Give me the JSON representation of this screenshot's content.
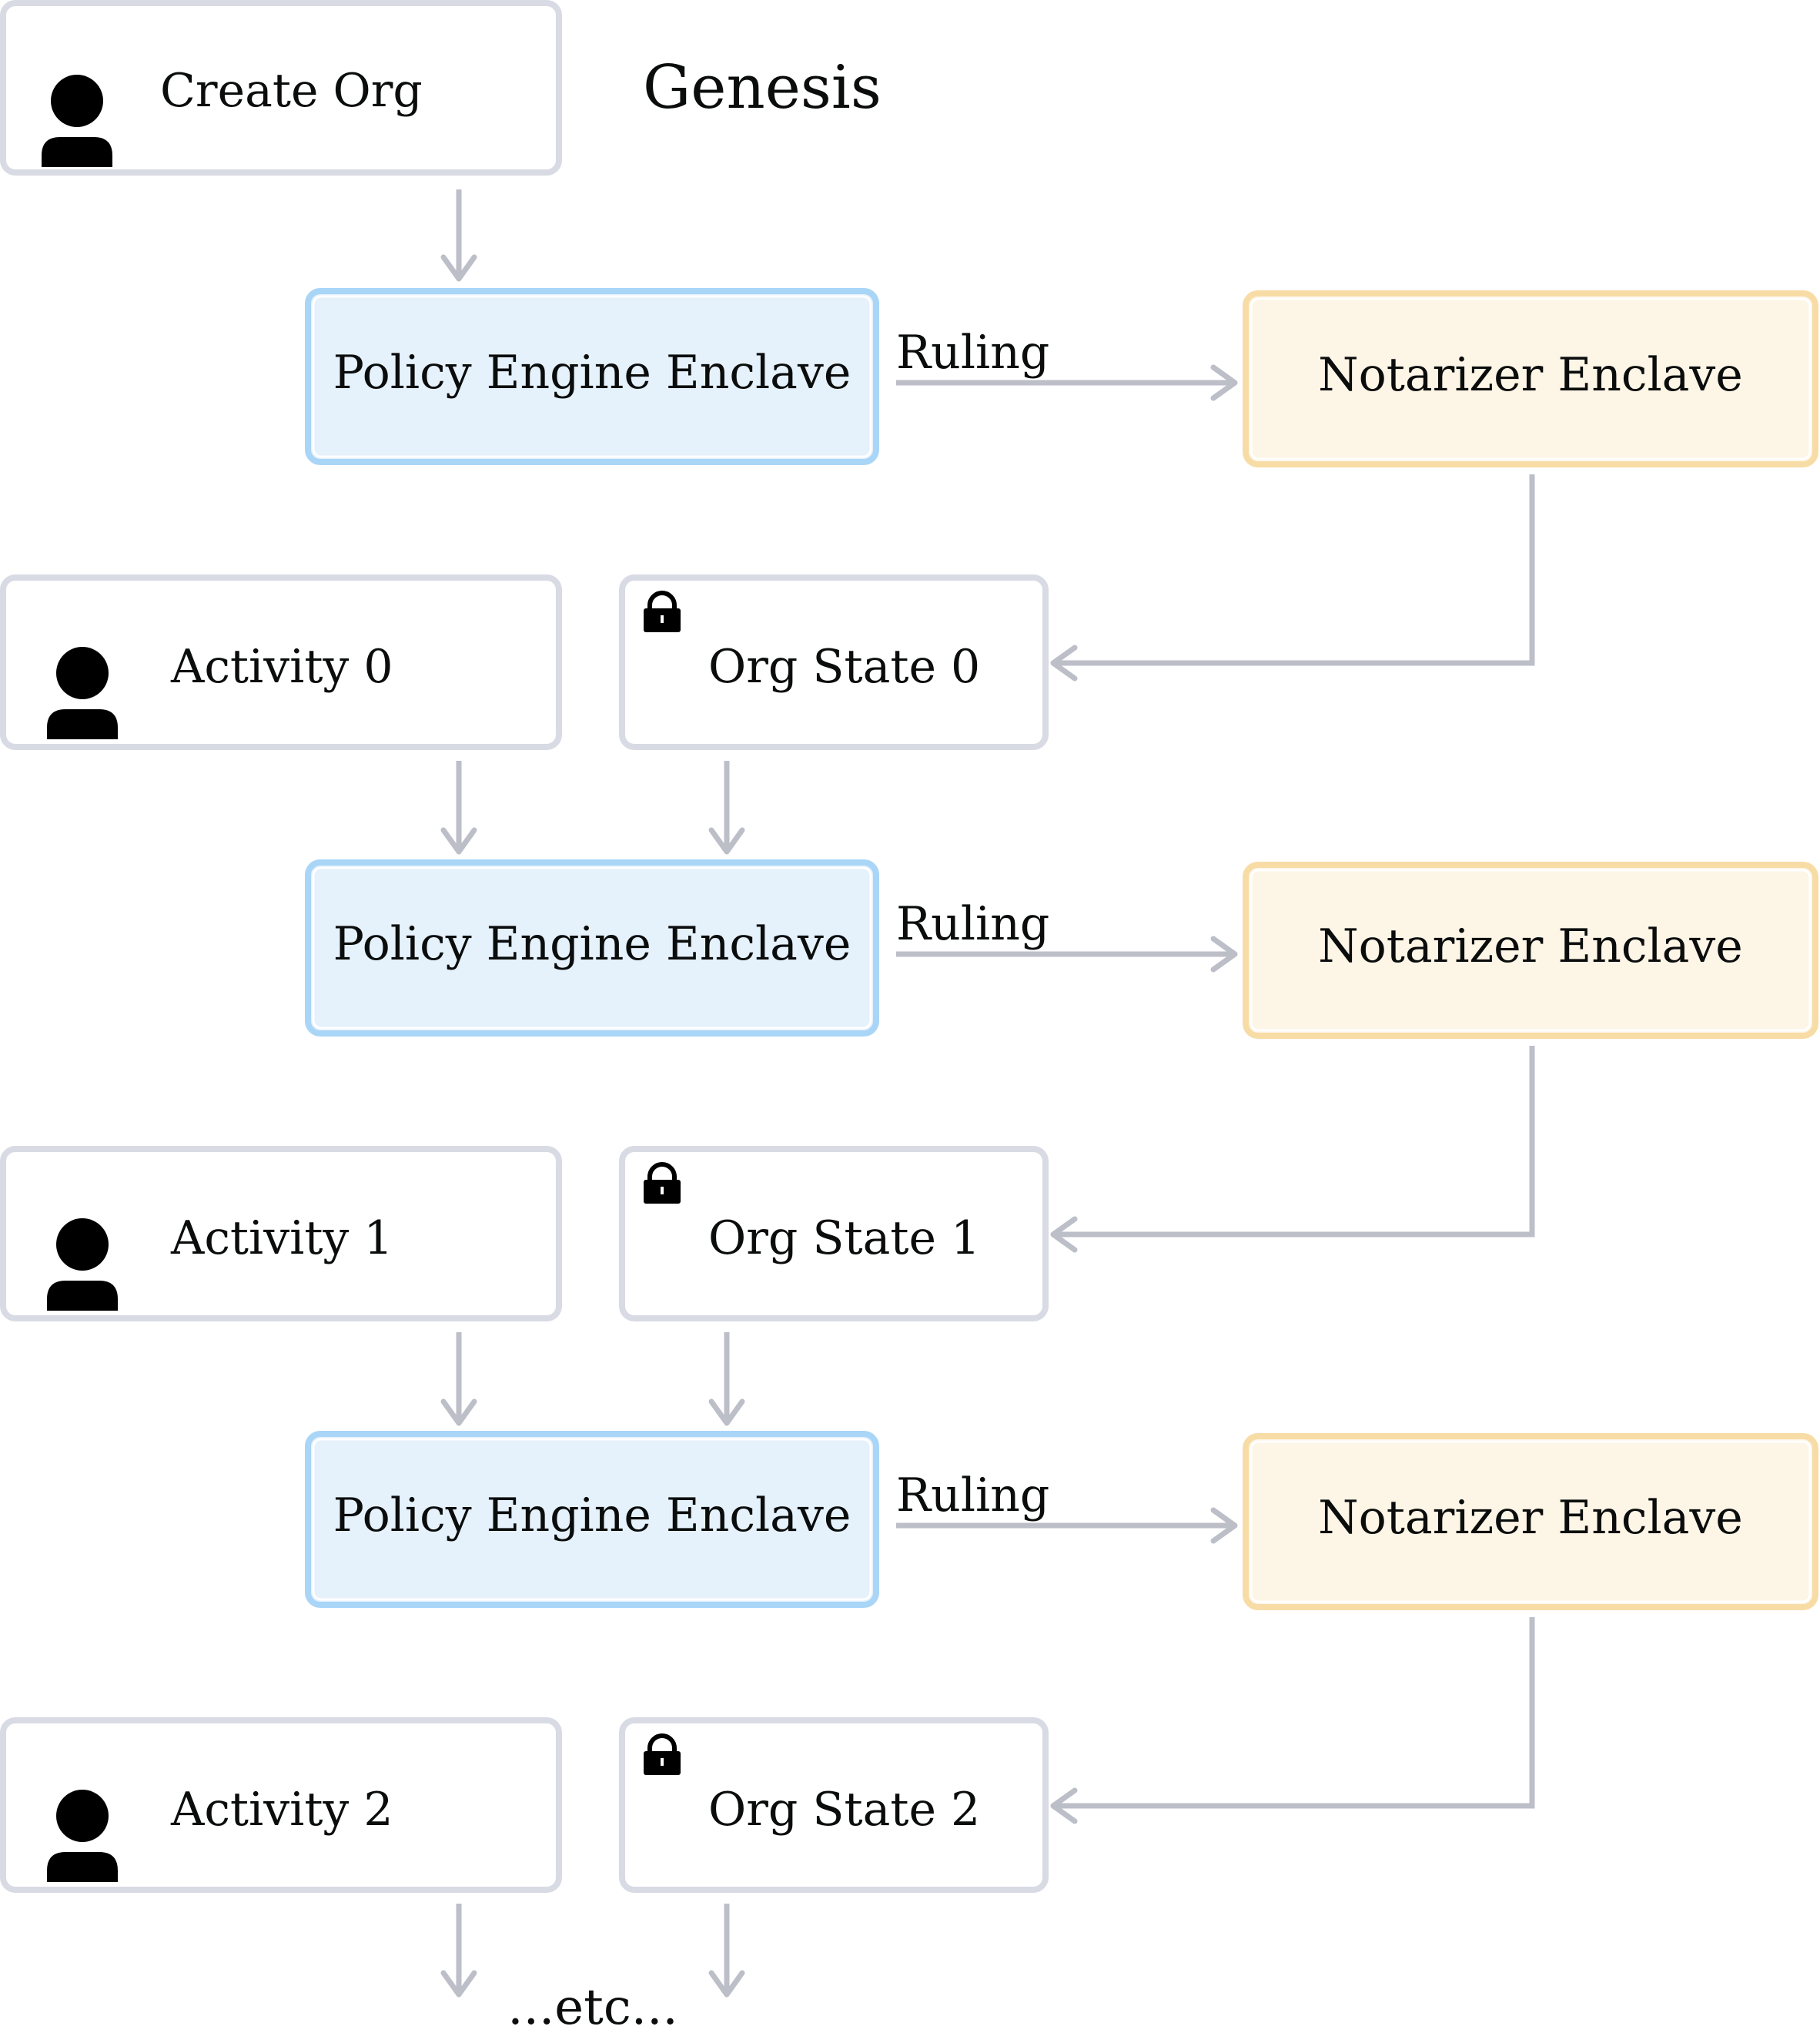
{
  "diagram": {
    "title": "Genesis",
    "colors": {
      "neutral_border": "#d8dbe4",
      "policy_border": "#a9d5f7",
      "policy_fill": "#e5f1fb",
      "notarizer_border": "#f8dca6",
      "notarizer_fill": "#fdf5e6",
      "arrow": "#bcbec8",
      "icon": "#000000",
      "text": "#0b0d0d"
    },
    "genesis": {
      "create_org": {
        "label": "Create Org",
        "icon": "person-icon"
      },
      "policy_engine": {
        "label": "Policy Engine Enclave"
      },
      "edge_label": "Ruling",
      "notarizer": {
        "label": "Notarizer Enclave"
      }
    },
    "steps": [
      {
        "activity": {
          "label": "Activity 0",
          "icon": "person-icon"
        },
        "org_state": {
          "label": "Org State 0",
          "icon": "lock-icon"
        },
        "policy_engine": {
          "label": "Policy Engine Enclave"
        },
        "edge_label": "Ruling",
        "notarizer": {
          "label": "Notarizer Enclave"
        }
      },
      {
        "activity": {
          "label": "Activity 1",
          "icon": "person-icon"
        },
        "org_state": {
          "label": "Org State 1",
          "icon": "lock-icon"
        },
        "policy_engine": {
          "label": "Policy Engine Enclave"
        },
        "edge_label": "Ruling",
        "notarizer": {
          "label": "Notarizer Enclave"
        }
      },
      {
        "activity": {
          "label": "Activity 2",
          "icon": "person-icon"
        },
        "org_state": {
          "label": "Org State 2",
          "icon": "lock-icon"
        }
      }
    ],
    "continuation": "...etc..."
  }
}
